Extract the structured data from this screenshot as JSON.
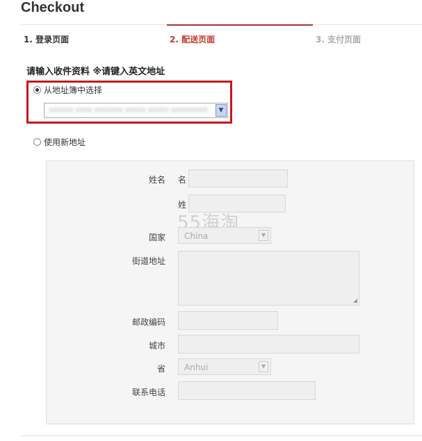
{
  "page": {
    "title": "Checkout"
  },
  "steps": [
    {
      "label": "1. 登录页面",
      "state": "done"
    },
    {
      "label": "2. 配送页面",
      "state": "active"
    },
    {
      "label": "3. 支付页面",
      "state": "pending"
    }
  ],
  "colors": {
    "active_step": "#c0392b",
    "highlight_border": "#c8161d"
  },
  "address": {
    "section_title": "请输入收件资料 ※请键入英文地址",
    "option_book": {
      "label": "从地址簿中选择",
      "checked": true
    },
    "book_select_value": "xxxxxx xxxx xxxxxxx xxxxx xxxxx xxxxxxxxx",
    "option_new": {
      "label": "使用新地址",
      "checked": false
    }
  },
  "form": {
    "name_label": "姓名",
    "first_name_label": "名",
    "last_name_label": "姓",
    "country_label": "国家",
    "country_value": "China",
    "street_label": "街道地址",
    "postcode_label": "邮政编码",
    "city_label": "城市",
    "province_label": "省",
    "province_value": "Anhui",
    "phone_label": "联系电话"
  },
  "watermark": "55海淘"
}
